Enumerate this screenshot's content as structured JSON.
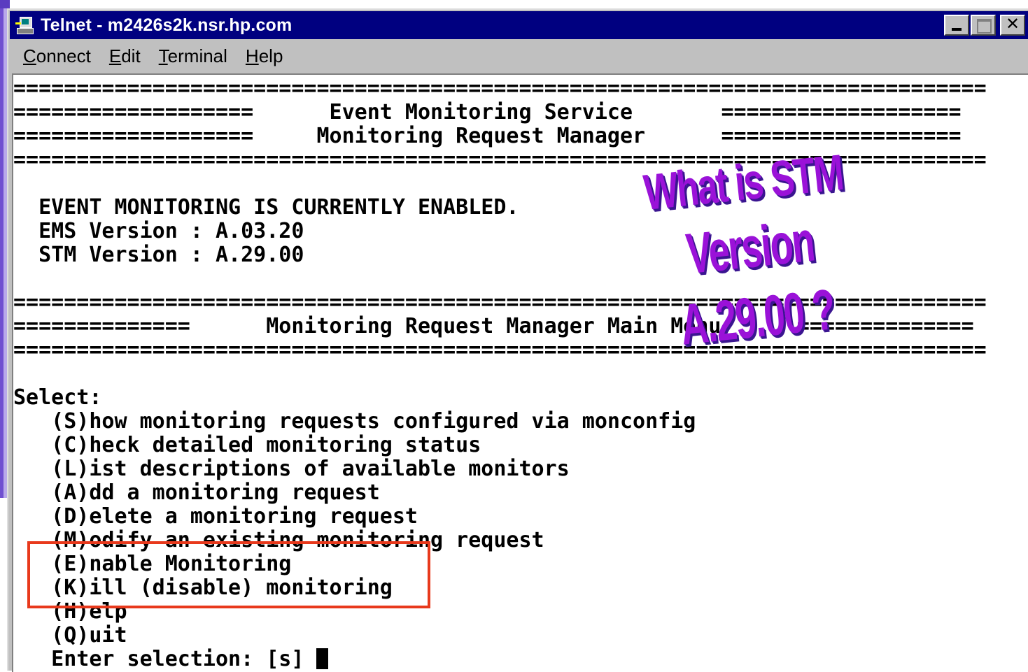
{
  "window": {
    "title": "Telnet - m2426s2k.nsr.hp.com"
  },
  "menu": [
    {
      "accel": "C",
      "rest": "onnect"
    },
    {
      "accel": "E",
      "rest": "dit"
    },
    {
      "accel": "T",
      "rest": "erminal"
    },
    {
      "accel": "H",
      "rest": "elp"
    }
  ],
  "terminal": {
    "lines": [
      "=============================================================================",
      "===================      Event Monitoring Service       ===================",
      "===================     Monitoring Request Manager      ===================",
      "=============================================================================",
      "",
      "  EVENT MONITORING IS CURRENTLY ENABLED.",
      "  EMS Version : A.03.20",
      "  STM Version : A.29.00",
      "",
      "=============================================================================",
      "==============      Monitoring Request Manager Main Menu      ==============",
      "=============================================================================",
      "",
      "Select:",
      "   (S)how monitoring requests configured via monconfig",
      "   (C)heck detailed monitoring status",
      "   (L)ist descriptions of available monitors",
      "   (A)dd a monitoring request",
      "   (D)elete a monitoring request",
      "   (M)odify an existing monitoring request",
      "   (E)nable Monitoring",
      "   (K)ill (disable) monitoring",
      "   (H)elp",
      "   (Q)uit",
      "   Enter selection: [s] "
    ]
  },
  "annotation": {
    "line1": "What is STM",
    "line2": "Version A.29.00 ?"
  },
  "colors": {
    "titlebar": "#000080",
    "highlight_box": "#e8391c",
    "wordart": "#9a12d8"
  }
}
